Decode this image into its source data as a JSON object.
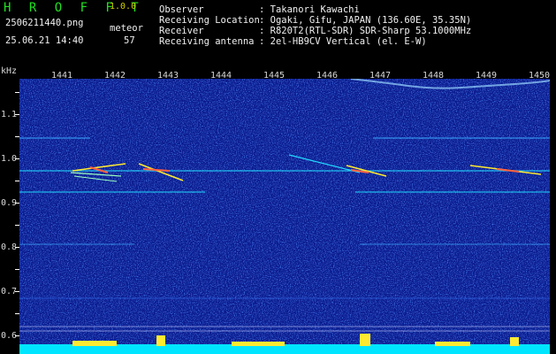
{
  "app": {
    "name": "H R O F F T",
    "version": "1.0.0"
  },
  "file": {
    "name": "2506211440.png",
    "datetime": "25.06.21 14:40"
  },
  "meteor": {
    "label": "meteor",
    "count": "57"
  },
  "info": [
    {
      "key": "Observer",
      "value": ": Takanori Kawachi"
    },
    {
      "key": "Receiving Location",
      "value": ": Ogaki, Gifu, JAPAN (136.60E, 35.35N)"
    },
    {
      "key": "Receiver",
      "value": ": R820T2(RTL-SDR) SDR-Sharp 53.1000MHz"
    },
    {
      "key": "Receiving antenna",
      "value": ": 2el-HB9CV Vertical (el. E-W)"
    }
  ],
  "axis": {
    "y_unit": "kHz",
    "y_labels": [
      "1.1",
      "1.0",
      "0.9",
      "0.8",
      "0.7",
      "0.6"
    ],
    "x_labels": [
      "1441",
      "1442",
      "1443",
      "1444",
      "1445",
      "1446",
      "1447",
      "1448",
      "1449",
      "1450"
    ]
  },
  "colors": {
    "background": "#0a1a8c",
    "noise": "#2a5cff",
    "line": "#22d8ff",
    "echo": "#ffea30",
    "bottom": "#00e5ff"
  }
}
